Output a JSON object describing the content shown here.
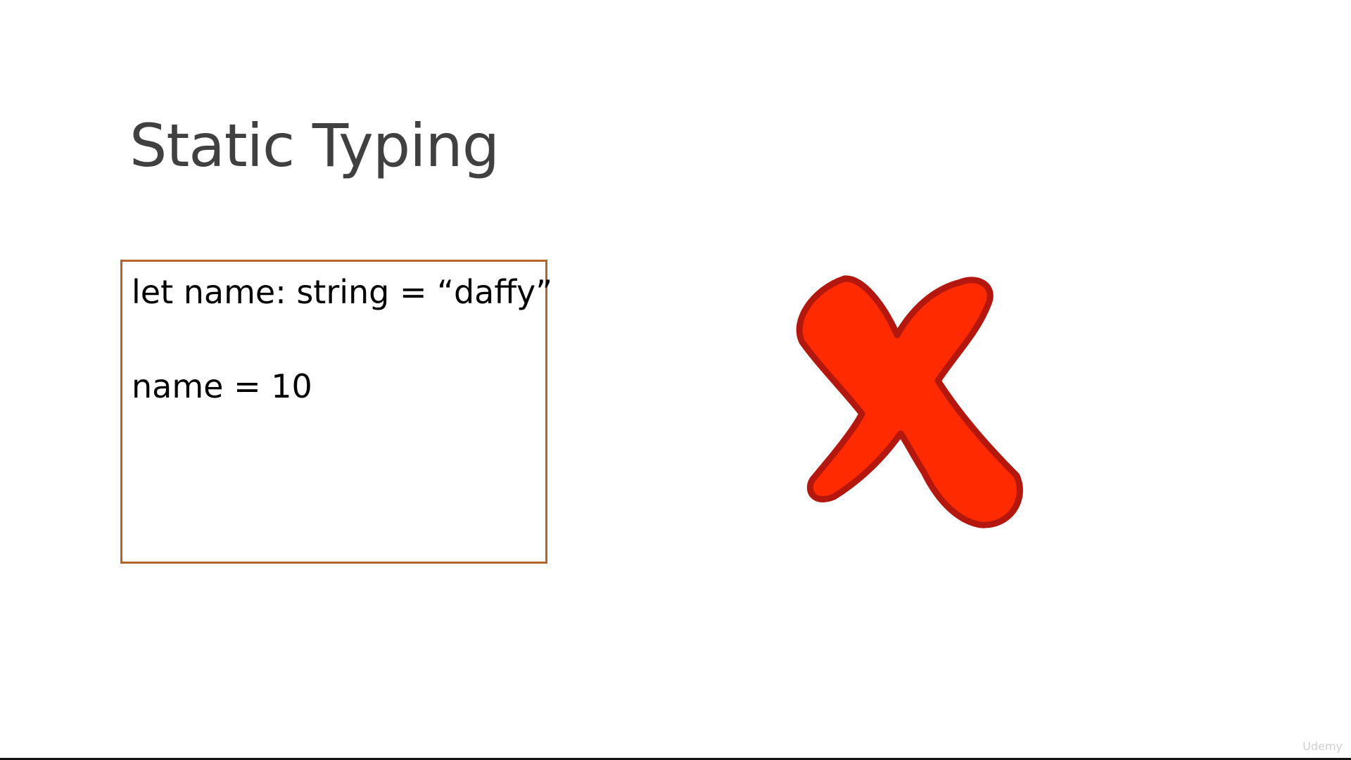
{
  "slide": {
    "title": "Static Typing",
    "code_lines": [
      "let name: string = “daffy”",
      "name = 10"
    ],
    "result_icon": "cross-mark-icon",
    "watermark": "Udemy"
  },
  "colors": {
    "title_text": "#404040",
    "box_border": "#b5652a",
    "x_fill": "#ff2a00",
    "x_stroke": "#b3170e"
  }
}
